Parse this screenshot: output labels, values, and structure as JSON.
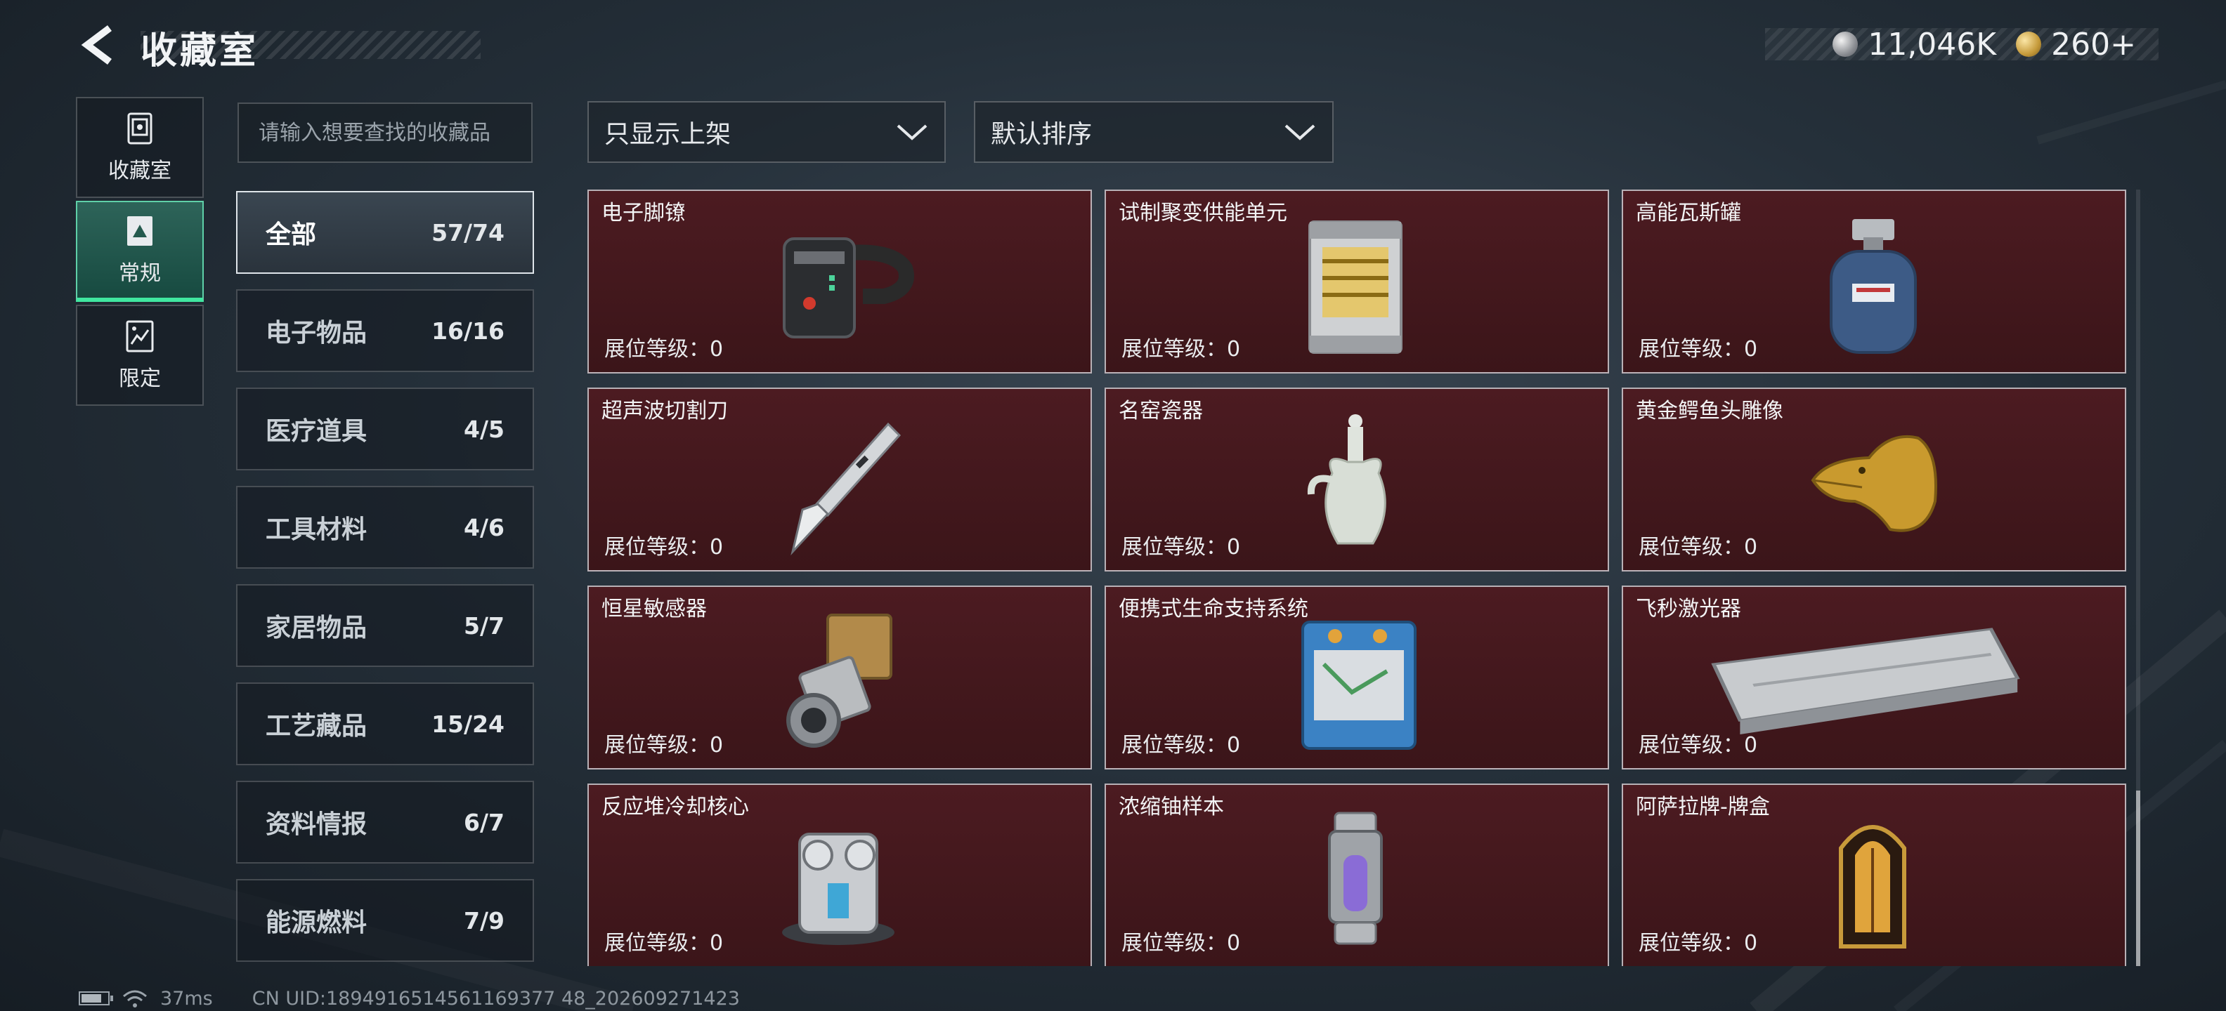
{
  "header": {
    "title": "收藏室",
    "currency_silver": "11,046K",
    "currency_gold": "260+"
  },
  "left_nav": [
    {
      "label": "收藏室",
      "icon": "vault-icon",
      "active": false
    },
    {
      "label": "常规",
      "icon": "regular-card-icon",
      "active": true
    },
    {
      "label": "限定",
      "icon": "limited-card-icon",
      "active": false
    }
  ],
  "search": {
    "placeholder": "请输入想要查找的收藏品",
    "value": ""
  },
  "categories": [
    {
      "name": "全部",
      "count": "57/74",
      "active": true
    },
    {
      "name": "电子物品",
      "count": "16/16"
    },
    {
      "name": "医疗道具",
      "count": "4/5"
    },
    {
      "name": "工具材料",
      "count": "4/6"
    },
    {
      "name": "家居物品",
      "count": "5/7"
    },
    {
      "name": "工艺藏品",
      "count": "15/24"
    },
    {
      "name": "资料情报",
      "count": "6/7"
    },
    {
      "name": "能源燃料",
      "count": "7/9"
    }
  ],
  "filters": {
    "display": "只显示上架",
    "sort": "默认排序"
  },
  "items": [
    {
      "name": "电子脚镣",
      "level_label": "展位等级：0",
      "icon": "ankle-monitor-icon"
    },
    {
      "name": "试制聚变供能单元",
      "level_label": "展位等级：0",
      "icon": "fusion-cell-icon"
    },
    {
      "name": "高能瓦斯罐",
      "level_label": "展位等级：0",
      "icon": "gas-canister-icon"
    },
    {
      "name": "超声波切割刀",
      "level_label": "展位等级：0",
      "icon": "ultrasonic-knife-icon"
    },
    {
      "name": "名窑瓷器",
      "level_label": "展位等级：0",
      "icon": "porcelain-vase-icon"
    },
    {
      "name": "黄金鳄鱼头雕像",
      "level_label": "展位等级：0",
      "icon": "gold-crocodile-statue-icon"
    },
    {
      "name": "恒星敏感器",
      "level_label": "展位等级：0",
      "icon": "star-sensor-icon"
    },
    {
      "name": "便携式生命支持系统",
      "level_label": "展位等级：0",
      "icon": "life-support-icon"
    },
    {
      "name": "飞秒激光器",
      "level_label": "展位等级：0",
      "icon": "femtosecond-laser-icon"
    },
    {
      "name": "反应堆冷却核心",
      "level_label": "展位等级：0",
      "icon": "reactor-core-icon"
    },
    {
      "name": "浓缩铀样本",
      "level_label": "展位等级：0",
      "icon": "uranium-sample-icon"
    },
    {
      "name": "阿萨拉牌-牌盒",
      "level_label": "展位等级：0",
      "icon": "card-box-icon"
    }
  ],
  "status": {
    "ping": "37ms",
    "uid": "CN UID:1894916514561169377 48_202609271423"
  }
}
